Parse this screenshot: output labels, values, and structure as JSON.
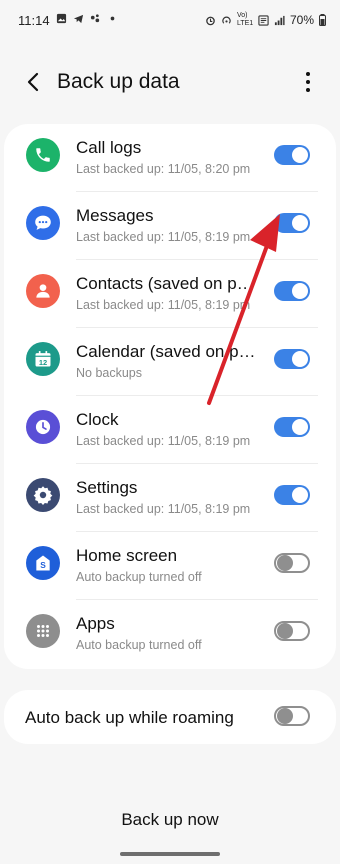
{
  "status_bar": {
    "time": "11:14",
    "battery": "70%",
    "network": "Vo) LTE1"
  },
  "header": {
    "title": "Back up data"
  },
  "items": [
    {
      "label": "Call logs",
      "sub": "Last backed up: 11/05, 8:20 pm",
      "enabled": true,
      "icon": "phone-icon",
      "color": "#1cb36a"
    },
    {
      "label": "Messages",
      "sub": "Last backed up: 11/05, 8:19 pm",
      "enabled": true,
      "icon": "chat-bubble-icon",
      "color": "#2f6ee8"
    },
    {
      "label": "Contacts (saved on ph…",
      "sub": "Last backed up: 11/05, 8:19 pm",
      "enabled": true,
      "icon": "person-icon",
      "color": "#f2614d"
    },
    {
      "label": "Calendar (saved on ph…",
      "sub": "No backups",
      "enabled": true,
      "icon": "calendar-icon",
      "color": "#1d9a8a"
    },
    {
      "label": "Clock",
      "sub": "Last backed up: 11/05, 8:19 pm",
      "enabled": true,
      "icon": "clock-icon",
      "color": "#5a4fd6"
    },
    {
      "label": "Settings",
      "sub": "Last backed up: 11/05, 8:19 pm",
      "enabled": true,
      "icon": "gear-icon",
      "color": "#3b4a72"
    },
    {
      "label": "Home screen",
      "sub": "Auto backup turned off",
      "enabled": false,
      "icon": "home-screen-icon",
      "color": "#1f5fd9"
    },
    {
      "label": "Apps",
      "sub": "Auto backup turned off",
      "enabled": false,
      "icon": "apps-grid-icon",
      "color": "#8e8e8e"
    }
  ],
  "roaming": {
    "label": "Auto back up while roaming",
    "enabled": false
  },
  "footer": {
    "backup_now_label": "Back up now"
  },
  "calendar_icon_day": "12",
  "colors": {
    "toggle_on": "#3b82e6",
    "arrow": "#d9232a"
  }
}
